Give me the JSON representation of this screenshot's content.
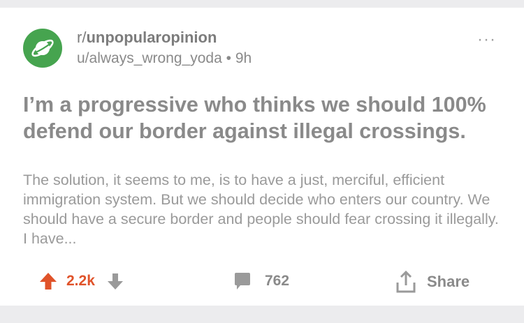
{
  "post": {
    "subreddit_prefix": "r/",
    "subreddit_name": "unpopularopinion",
    "author": "u/always_wrong_yoda",
    "separator": "•",
    "age": "9h",
    "more_label": "···",
    "title": "I’m a progressive who thinks we should 100% defend our border against illegal crossings.",
    "body": "The solution, it seems to me, is to have a just, merciful, efficient immigration system.  But we should decide who enters our country. We should have a secure border and people should fear crossing it illegally.  I have...",
    "score": "2.2k",
    "comments": "762",
    "share_label": "Share"
  },
  "icons": {
    "avatar": "planet-icon",
    "upvote": "upvote-arrow-icon",
    "downvote": "downvote-arrow-icon",
    "comments": "comment-bubble-icon",
    "share": "share-upload-icon",
    "more": "more-options-icon"
  },
  "colors": {
    "avatar_bg": "#46a44f",
    "upvote_active": "#e0532a",
    "muted_text": "#8a8a8a",
    "icon_gray": "#9a9a9a"
  }
}
